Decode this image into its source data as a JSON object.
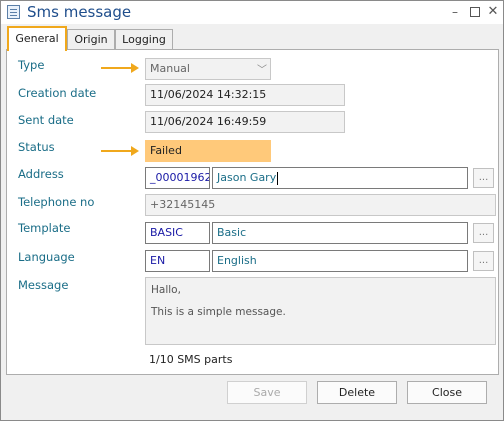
{
  "window": {
    "title": "Sms message"
  },
  "tabs": [
    {
      "label": "General",
      "active": true
    },
    {
      "label": "Origin",
      "active": false
    },
    {
      "label": "Logging",
      "active": false
    }
  ],
  "form": {
    "type": {
      "label": "Type",
      "value": "Manual"
    },
    "creation_date": {
      "label": "Creation date",
      "value": "11/06/2024 14:32:15"
    },
    "sent_date": {
      "label": "Sent date",
      "value": "11/06/2024 16:49:59"
    },
    "status": {
      "label": "Status",
      "value": "Failed",
      "color": "#ffc97a"
    },
    "address": {
      "label": "Address",
      "code": "_00001962",
      "name": "Jason Gary"
    },
    "telephone": {
      "label": "Telephone no",
      "value": "+32145145"
    },
    "template": {
      "label": "Template",
      "code": "BASIC",
      "name": "Basic"
    },
    "language": {
      "label": "Language",
      "code": "EN",
      "name": "English"
    },
    "message": {
      "label": "Message",
      "line1": "Hallo,",
      "line2": "This is a simple message."
    },
    "parts": "1/10 SMS parts"
  },
  "buttons": {
    "save": "Save",
    "delete": "Delete",
    "close": "Close"
  },
  "ellipsis_label": "...",
  "colors": {
    "accent_orange": "#f0a81c",
    "title_blue": "#1f4e8c",
    "label_teal": "#1a6d87"
  }
}
